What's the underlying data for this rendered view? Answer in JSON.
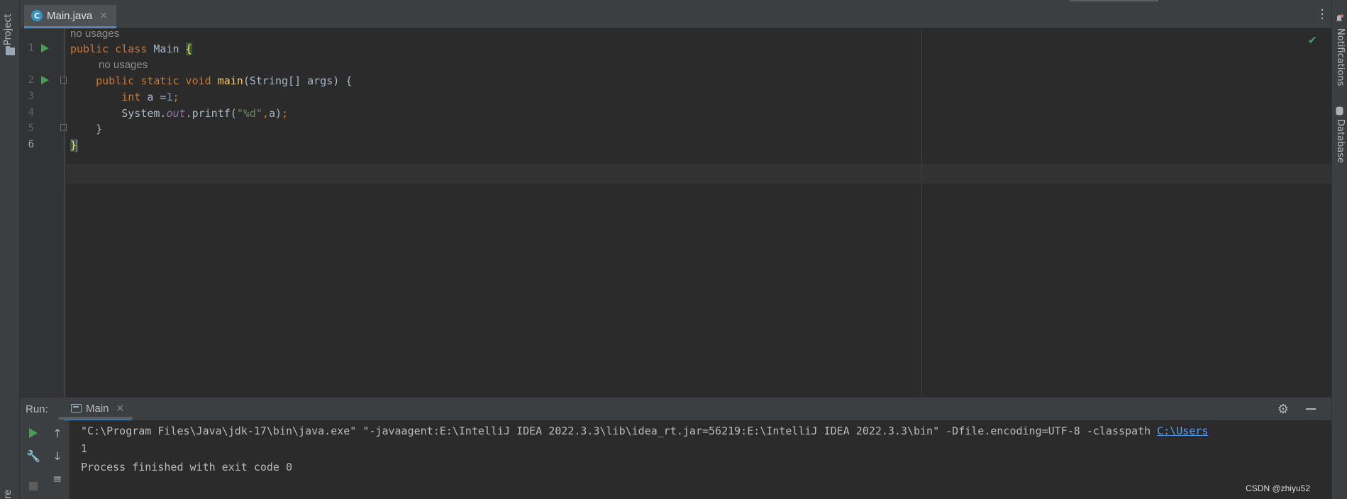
{
  "left_strip": {
    "project_label": "Project",
    "structure_label": "ure"
  },
  "right_strip": {
    "notifications_label": "Notifications",
    "database_label": "Database"
  },
  "editor_tab": {
    "icon_letter": "C",
    "label": "Main.java",
    "close": "×"
  },
  "editor": {
    "line_numbers": [
      "1",
      "2",
      "3",
      "4",
      "5",
      "6"
    ],
    "hints": [
      "no usages",
      "no usages"
    ],
    "lines": [
      {
        "parts": [
          [
            "kw",
            "public class "
          ],
          [
            "plain",
            "Main "
          ],
          [
            "brace",
            "{"
          ]
        ]
      },
      {
        "parts": [
          [
            "plain",
            "    "
          ],
          [
            "kw",
            "public static void "
          ],
          [
            "fn",
            "main"
          ],
          [
            "plain",
            "(String[] args) {"
          ]
        ]
      },
      {
        "parts": [
          [
            "plain",
            "        "
          ],
          [
            "kw",
            "int "
          ],
          [
            "plain",
            "a ="
          ],
          [
            "num",
            "1"
          ],
          [
            "kw",
            ";"
          ]
        ]
      },
      {
        "parts": [
          [
            "plain",
            "        System."
          ],
          [
            "fld",
            "out"
          ],
          [
            "plain",
            ".printf("
          ],
          [
            "str",
            "\"%d\""
          ],
          [
            "kw",
            ","
          ],
          [
            "plain",
            "a)"
          ],
          [
            "kw",
            ";"
          ]
        ]
      },
      {
        "parts": [
          [
            "plain",
            "    }"
          ]
        ]
      },
      {
        "parts": [
          [
            "brace",
            "}"
          ]
        ]
      }
    ]
  },
  "run_panel": {
    "label": "Run:",
    "tab_label": "Main",
    "tab_close": "×",
    "console": {
      "command": "\"C:\\Program Files\\Java\\jdk-17\\bin\\java.exe\" \"-javaagent:E:\\IntelliJ IDEA 2022.3.3\\lib\\idea_rt.jar=56219:E:\\IntelliJ IDEA 2022.3.3\\bin\" -Dfile.encoding=UTF-8 -classpath ",
      "command_link": "C:\\Users",
      "output": "1",
      "exit_message": "Process finished with exit code 0"
    }
  },
  "watermark": "CSDN @zhiyu52",
  "colors": {
    "keyword": "#cc7832",
    "function": "#ffc66d",
    "number": "#6897bb",
    "string": "#6a8759",
    "field": "#9876aa",
    "accent": "#4a88c7",
    "run_green": "#499c54"
  }
}
